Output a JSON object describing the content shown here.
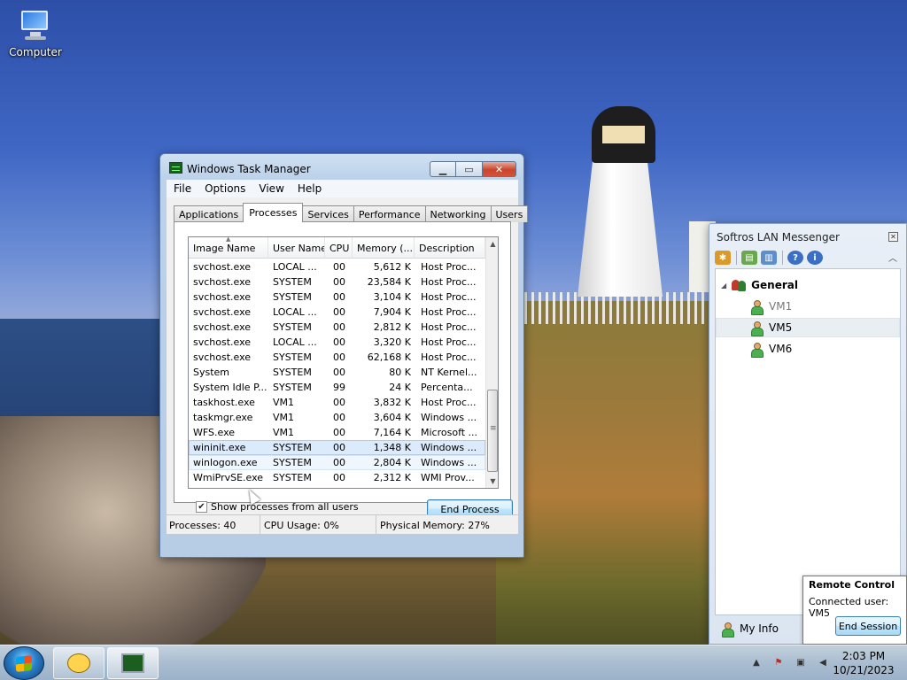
{
  "desktop": {
    "icon_label": "Computer"
  },
  "task_manager": {
    "title": "Windows Task Manager",
    "menu": [
      "File",
      "Options",
      "View",
      "Help"
    ],
    "tabs": [
      "Applications",
      "Processes",
      "Services",
      "Performance",
      "Networking",
      "Users"
    ],
    "active_tab": "Processes",
    "columns": [
      "Image Name",
      "User Name",
      "CPU",
      "Memory (...",
      "Description"
    ],
    "rows": [
      [
        "svchost.exe",
        "LOCAL ...",
        "00",
        "5,612 K",
        "Host Proc..."
      ],
      [
        "svchost.exe",
        "SYSTEM",
        "00",
        "23,584 K",
        "Host Proc..."
      ],
      [
        "svchost.exe",
        "SYSTEM",
        "00",
        "3,104 K",
        "Host Proc..."
      ],
      [
        "svchost.exe",
        "LOCAL ...",
        "00",
        "7,904 K",
        "Host Proc..."
      ],
      [
        "svchost.exe",
        "SYSTEM",
        "00",
        "2,812 K",
        "Host Proc..."
      ],
      [
        "svchost.exe",
        "LOCAL ...",
        "00",
        "3,320 K",
        "Host Proc..."
      ],
      [
        "svchost.exe",
        "SYSTEM",
        "00",
        "62,168 K",
        "Host Proc..."
      ],
      [
        "System",
        "SYSTEM",
        "00",
        "80 K",
        "NT Kernel..."
      ],
      [
        "System Idle P...",
        "SYSTEM",
        "99",
        "24 K",
        "Percenta..."
      ],
      [
        "taskhost.exe",
        "VM1",
        "00",
        "3,832 K",
        "Host Proc..."
      ],
      [
        "taskmgr.exe",
        "VM1",
        "00",
        "3,604 K",
        "Windows ..."
      ],
      [
        "WFS.exe",
        "VM1",
        "00",
        "7,164 K",
        "Microsoft ..."
      ],
      [
        "wininit.exe",
        "SYSTEM",
        "00",
        "1,348 K",
        "Windows ..."
      ],
      [
        "winlogon.exe",
        "SYSTEM",
        "00",
        "2,804 K",
        "Windows ..."
      ],
      [
        "WmiPrvSE.exe",
        "SYSTEM",
        "00",
        "2,312 K",
        "WMI Prov..."
      ]
    ],
    "selected_row": "wininit.exe",
    "show_all_label": "Show processes from all users",
    "show_all_checked": true,
    "end_process_label": "End Process",
    "status": {
      "processes": "Processes: 40",
      "cpu": "CPU Usage: 0%",
      "memory": "Physical Memory: 27%"
    }
  },
  "messenger": {
    "title": "Softros LAN Messenger",
    "group": "General",
    "users": [
      "VM1",
      "VM5",
      "VM6"
    ],
    "highlighted_user": "VM5",
    "my_info_label": "My Info",
    "remote_control": {
      "title": "Remote Control",
      "text": "Connected user: VM5",
      "end_session_label": "End Session"
    }
  },
  "taskbar": {
    "time": "2:03 PM",
    "date": "10/21/2023"
  }
}
